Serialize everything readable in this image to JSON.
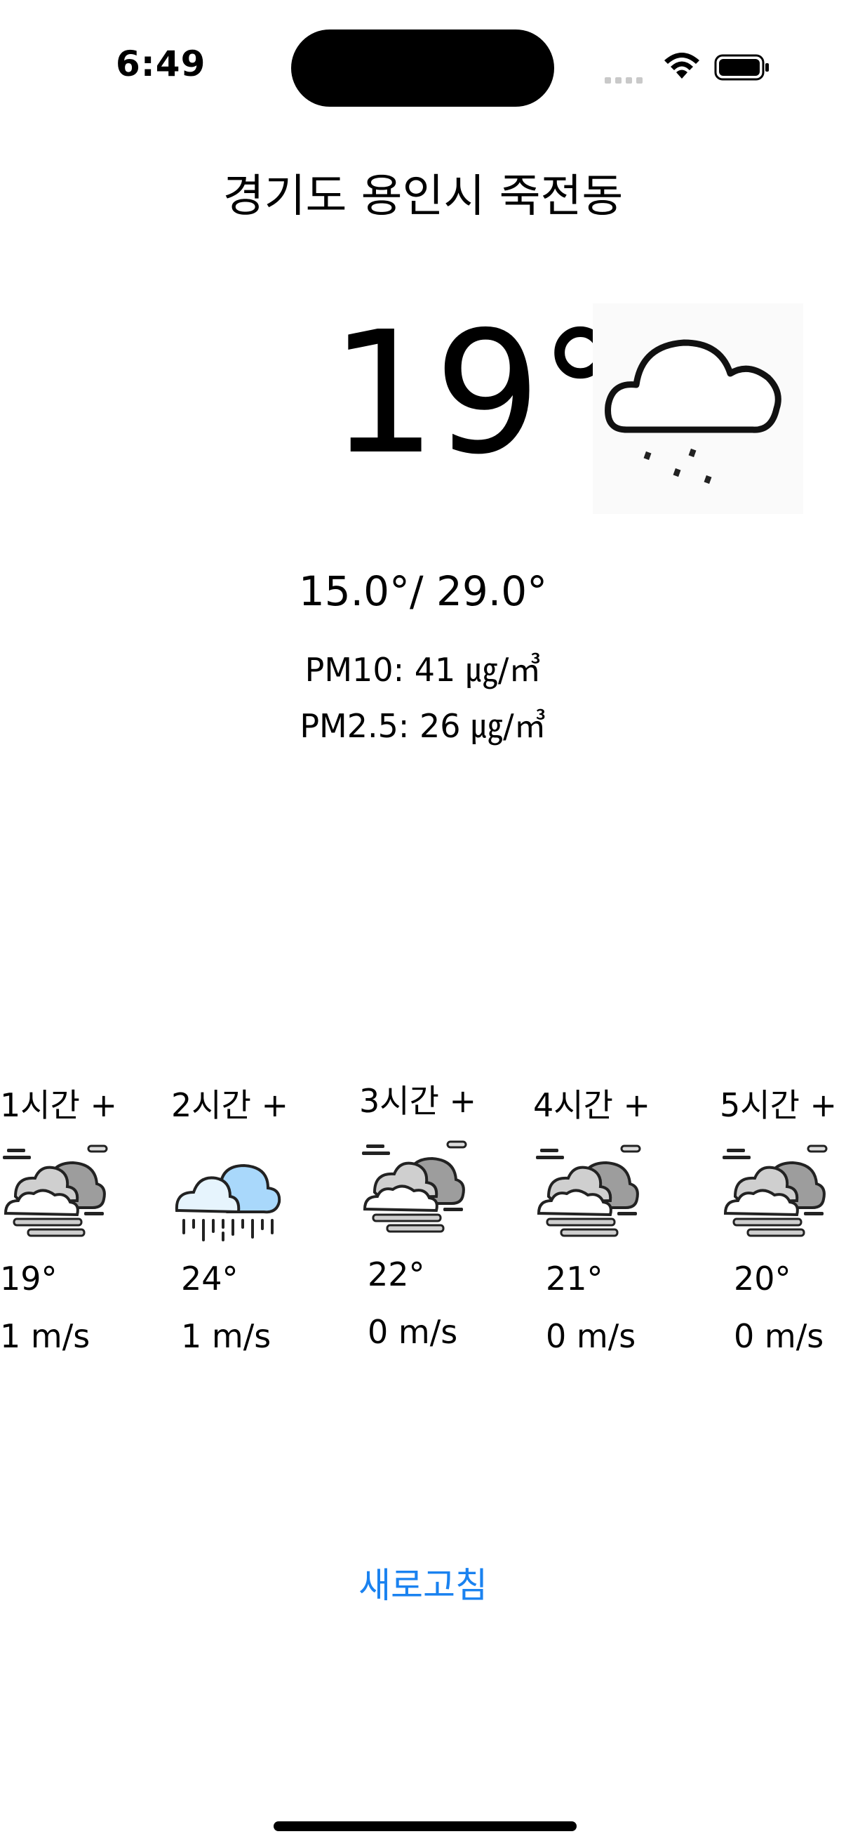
{
  "status_bar": {
    "time": "6:49"
  },
  "location": "경기도 용인시 죽전동",
  "current": {
    "temperature": "19°",
    "icon": "cloud-drizzle-icon",
    "min_max": "15.0°/ 29.0°",
    "pm10": "PM10: 41 ㎍/㎥",
    "pm25": "PM2.5: 26 ㎍/㎥"
  },
  "hourly": [
    {
      "label": "1시간 +",
      "icon": "fog-cloud-icon",
      "temp": "19°",
      "wind": "1 m/s"
    },
    {
      "label": "2시간 +",
      "icon": "rain-cloud-icon",
      "temp": "24°",
      "wind": "1 m/s"
    },
    {
      "label": "3시간 +",
      "icon": "fog-cloud-icon",
      "temp": "22°",
      "wind": "0 m/s"
    },
    {
      "label": "4시간 +",
      "icon": "fog-cloud-icon",
      "temp": "21°",
      "wind": "0 m/s"
    },
    {
      "label": "5시간 +",
      "icon": "fog-cloud-icon",
      "temp": "20°",
      "wind": "0 m/s"
    }
  ],
  "refresh_label": "새로고침",
  "colors": {
    "accent": "#1a82f0",
    "text": "#000000",
    "background": "#ffffff"
  }
}
